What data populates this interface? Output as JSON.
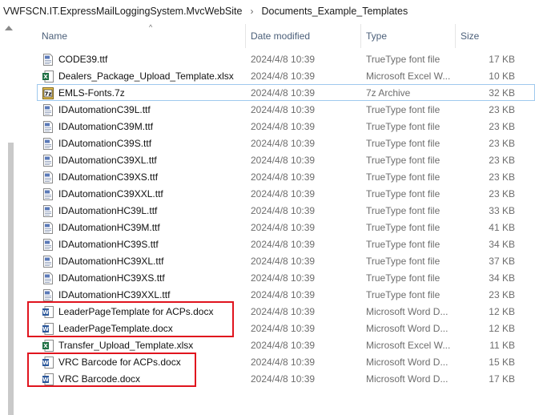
{
  "breadcrumb": [
    "VWFSCN.IT.ExpressMailLoggingSystem.MvcWebSite",
    "Documents_Example_Templates"
  ],
  "breadcrumb_separator": "›",
  "columns": {
    "name": "Name",
    "date": "Date modified",
    "type": "Type",
    "size": "Size"
  },
  "sort_indicator": "^",
  "files": [
    {
      "name": "CODE39.ttf",
      "date": "2024/4/8 10:39",
      "type": "TrueType font file",
      "size": "17 KB",
      "icon": "font-file-icon"
    },
    {
      "name": "Dealers_Package_Upload_Template.xlsx",
      "date": "2024/4/8 10:39",
      "type": "Microsoft Excel W...",
      "size": "10 KB",
      "icon": "excel-file-icon"
    },
    {
      "name": "EMLS-Fonts.7z",
      "date": "2024/4/8 10:39",
      "type": "7z Archive",
      "size": "32 KB",
      "icon": "archive-7z-icon"
    },
    {
      "name": "IDAutomationC39L.ttf",
      "date": "2024/4/8 10:39",
      "type": "TrueType font file",
      "size": "23 KB",
      "icon": "font-file-icon"
    },
    {
      "name": "IDAutomationC39M.ttf",
      "date": "2024/4/8 10:39",
      "type": "TrueType font file",
      "size": "23 KB",
      "icon": "font-file-icon"
    },
    {
      "name": "IDAutomationC39S.ttf",
      "date": "2024/4/8 10:39",
      "type": "TrueType font file",
      "size": "23 KB",
      "icon": "font-file-icon"
    },
    {
      "name": "IDAutomationC39XL.ttf",
      "date": "2024/4/8 10:39",
      "type": "TrueType font file",
      "size": "23 KB",
      "icon": "font-file-icon"
    },
    {
      "name": "IDAutomationC39XS.ttf",
      "date": "2024/4/8 10:39",
      "type": "TrueType font file",
      "size": "23 KB",
      "icon": "font-file-icon"
    },
    {
      "name": "IDAutomationC39XXL.ttf",
      "date": "2024/4/8 10:39",
      "type": "TrueType font file",
      "size": "23 KB",
      "icon": "font-file-icon"
    },
    {
      "name": "IDAutomationHC39L.ttf",
      "date": "2024/4/8 10:39",
      "type": "TrueType font file",
      "size": "33 KB",
      "icon": "font-file-icon"
    },
    {
      "name": "IDAutomationHC39M.ttf",
      "date": "2024/4/8 10:39",
      "type": "TrueType font file",
      "size": "41 KB",
      "icon": "font-file-icon"
    },
    {
      "name": "IDAutomationHC39S.ttf",
      "date": "2024/4/8 10:39",
      "type": "TrueType font file",
      "size": "34 KB",
      "icon": "font-file-icon"
    },
    {
      "name": "IDAutomationHC39XL.ttf",
      "date": "2024/4/8 10:39",
      "type": "TrueType font file",
      "size": "37 KB",
      "icon": "font-file-icon"
    },
    {
      "name": "IDAutomationHC39XS.ttf",
      "date": "2024/4/8 10:39",
      "type": "TrueType font file",
      "size": "34 KB",
      "icon": "font-file-icon"
    },
    {
      "name": "IDAutomationHC39XXL.ttf",
      "date": "2024/4/8 10:39",
      "type": "TrueType font file",
      "size": "23 KB",
      "icon": "font-file-icon"
    },
    {
      "name": "LeaderPageTemplate for ACPs.docx",
      "date": "2024/4/8 10:39",
      "type": "Microsoft Word D...",
      "size": "12 KB",
      "icon": "word-file-icon"
    },
    {
      "name": "LeaderPageTemplate.docx",
      "date": "2024/4/8 10:39",
      "type": "Microsoft Word D...",
      "size": "12 KB",
      "icon": "word-file-icon"
    },
    {
      "name": "Transfer_Upload_Template.xlsx",
      "date": "2024/4/8 10:39",
      "type": "Microsoft Excel W...",
      "size": "11 KB",
      "icon": "excel-file-icon"
    },
    {
      "name": "VRC Barcode for ACPs.docx",
      "date": "2024/4/8 10:39",
      "type": "Microsoft Word D...",
      "size": "15 KB",
      "icon": "word-file-icon"
    },
    {
      "name": "VRC Barcode.docx",
      "date": "2024/4/8 10:39",
      "type": "Microsoft Word D...",
      "size": "17 KB",
      "icon": "word-file-icon"
    }
  ],
  "colors": {
    "highlight": "#e0141e",
    "header_text": "#4c607a",
    "excel": "#1d6f42",
    "word": "#2b579a",
    "archive": "#f2c94c"
  }
}
